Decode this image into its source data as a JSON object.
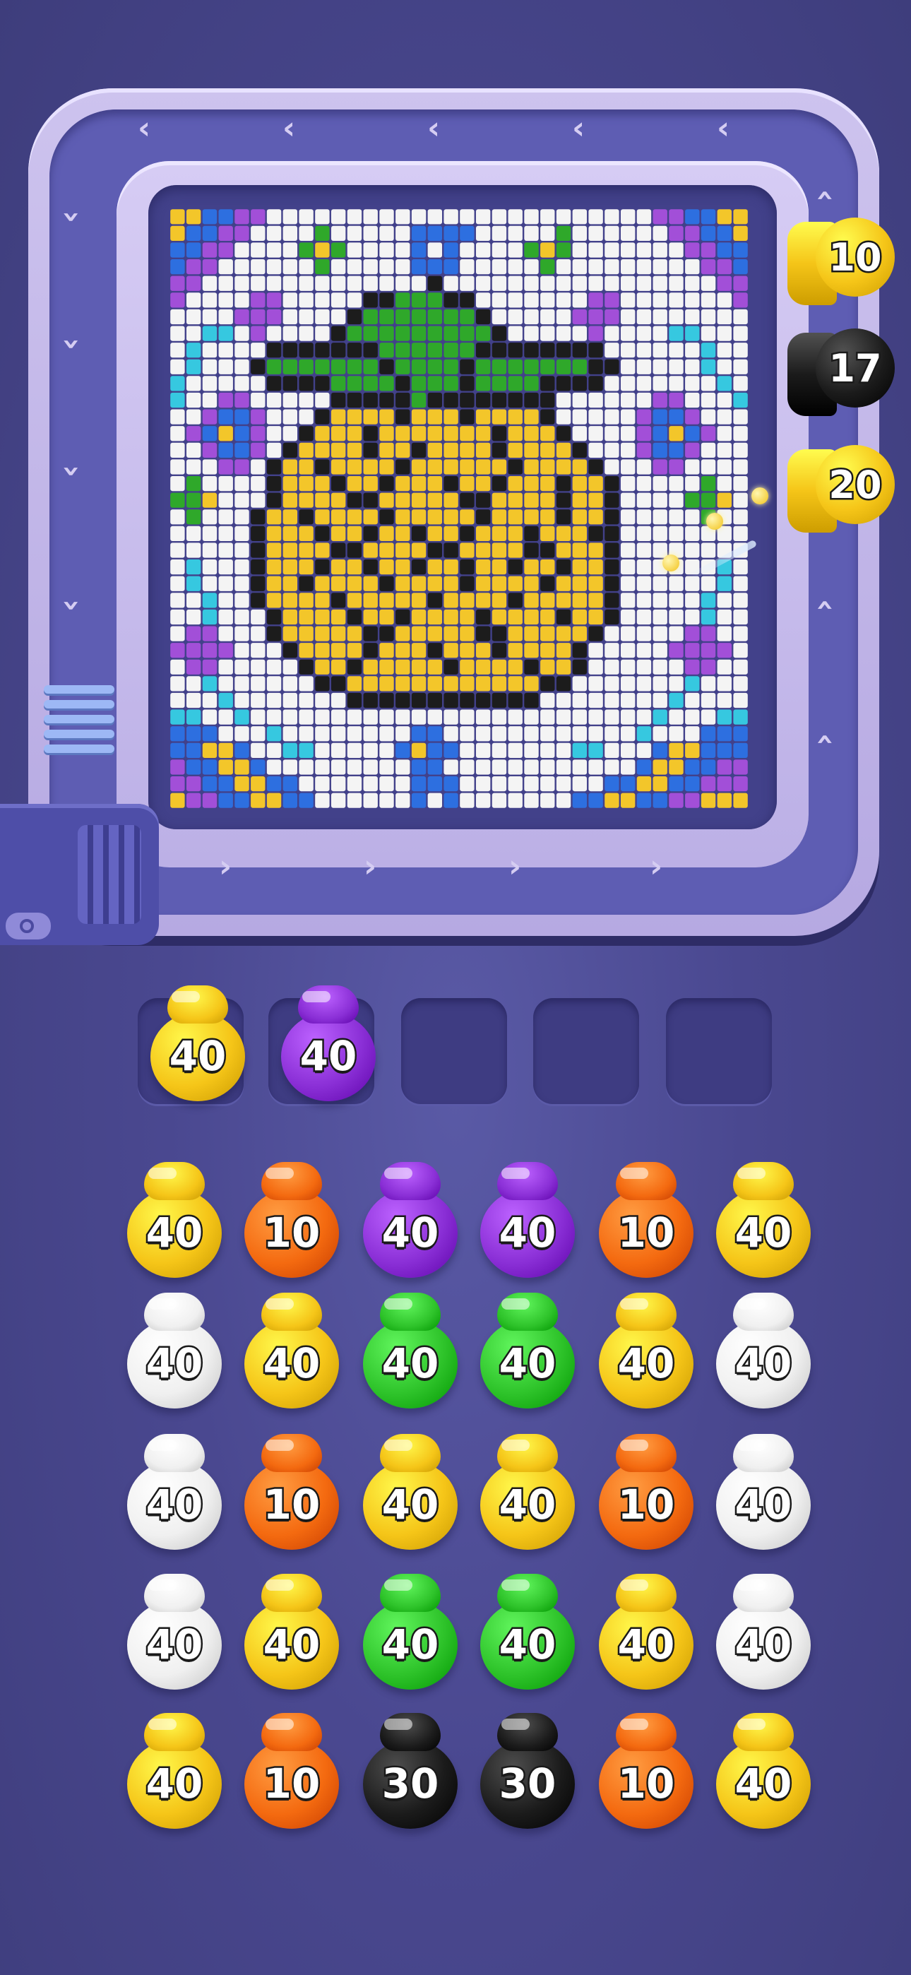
{
  "colors": {
    "yellow": "#f5c518",
    "orange": "#f46a10",
    "purple": "#8a2fd6",
    "green": "#2ec32a",
    "white": "#f0f0f0",
    "black": "#1b1b1b"
  },
  "picture": {
    "subject": "pineapple",
    "rows": [
      "yybbppwwwwwwwwwwwwwwwwwwwwwwwwppbbyy",
      "ybbppwwwwgwwwwwbbbbwwwwwgwwwwwwppbby",
      "bbppwwwwgygwwwwbwbwwwwgygwwwwwwwppbb",
      "bppwwwwwwgwwwwwbbbwwwwwgwwwwwwwwwppb",
      "ppwwwwwwwwwwwwwwkwwwwwwwwwwwwwwwwwpp",
      "pwwwwppwwwwwkkgggkkwwwwwwwppwwwwwwwp",
      "wwwwpppwwwwkgggggggkwwwwwpppwwwwwwww",
      "wwccwpwwwwkgggggggggkwwwwwpwwwwccwww",
      "wcwwwwkkkkkkkggggggkkkkkkkkwwwwwwcww",
      "wcwwwkgggggggkggggkgggggggkkwwwwwcww",
      "cwwwwwkkkkggggkgggkggggkkkkwwwwwwwcw",
      "cwwppwwwwwkkkkkgkkkkkkkkwwwwwwppwwwc",
      "wwpbbpwwwkyyyykyyykyyyykwwwwwpbbpwww",
      "wpbybpwwkyyykyyyyyyykyyykwwwwpbybpww",
      "wwpbbpwkyyyykyykyyyykyyyykwwwpbbpwww",
      "wwwppwkyykyyyykyyyyyykyyyykwwwppwwww",
      "wgwwwwkyyykyykyyykyykyyykyykwwwwwgww",
      "ggywwwkyyyykkyyyyykkyyyykyykwwwwggyw",
      "wgwwwkyykyyyykyyyyykyyyykyykwwwwwgww",
      "wwwwwkyyykyykyykyykyyykyyykkwwwwwwww",
      "wwwwwkyyyykkyyyykkyyyykkyyykwwwwwwww",
      "wcwwwkyyykyykyykyykyykyykyykwwwwwwcw",
      "wcwwwkyykyyyykyyyykyyyykyyykwwwwwwcw",
      "wwcwwkyyyykyyyyykyyyykyyyyykwwwwwcww",
      "wwcwwwkyyyykyykyyyykyyyykyykwwwwwcww",
      "wppwwwkyyyyykkyyyyykkyyyyykwwwwwppww",
      "ppppwwwkyyyykyyykyyykyyyykwwwwwppppw",
      "wppwwwwwkyykyyyyykyyyykyykwwwwwwppww",
      "wwcwwwwwwkkyyyyyyyyyyyykkwwwwwwwcwww",
      "wwwcwwwwwwwkkkkkkkkkkkkwwwwwwwwcwwww",
      "ccwwcwwwwwwwwwwwwwwwwwwwwwwwwwcwwwcc",
      "bbbwwwcwwwwwwwwbbwwwwwwwwwwwwcwwwbbb",
      "bbyybwwccwwwwwbybbwwwwwwwccwwwbyybbb",
      "pbbyybwwwwwwwwwbbwwwwwwwwwwwwbyybbpp",
      "ppbbyybbwwwwwwwbbbwwwwwwwwwbbyybbppp",
      "yppbbyybbwwwwwwbwbwwwwwwwbbyybbppyyy"
    ]
  },
  "side_shooters": [
    {
      "value": "10",
      "color": "#f5c518"
    },
    {
      "value": "17",
      "color": "#1b1b1b"
    },
    {
      "value": "20",
      "color": "#f5c518"
    }
  ],
  "queue_slots": [
    {
      "value": "40",
      "color": "#f5c518",
      "filled": true
    },
    {
      "value": "40",
      "color": "#8a2fd6",
      "filled": true
    },
    {
      "value": "",
      "color": "",
      "filled": false
    },
    {
      "value": "",
      "color": "",
      "filled": false
    },
    {
      "value": "",
      "color": "",
      "filled": false
    }
  ],
  "pots": [
    [
      {
        "value": "40",
        "color": "#f5c518"
      },
      {
        "value": "10",
        "color": "#f46a10"
      },
      {
        "value": "40",
        "color": "#8a2fd6"
      },
      {
        "value": "40",
        "color": "#8a2fd6"
      },
      {
        "value": "10",
        "color": "#f46a10"
      },
      {
        "value": "40",
        "color": "#f5c518"
      }
    ],
    [
      {
        "value": "40",
        "color": "#f0f0f0"
      },
      {
        "value": "40",
        "color": "#f5c518"
      },
      {
        "value": "40",
        "color": "#2ec32a"
      },
      {
        "value": "40",
        "color": "#2ec32a"
      },
      {
        "value": "40",
        "color": "#f5c518"
      },
      {
        "value": "40",
        "color": "#f0f0f0"
      }
    ],
    [
      {
        "value": "40",
        "color": "#f0f0f0"
      },
      {
        "value": "10",
        "color": "#f46a10"
      },
      {
        "value": "40",
        "color": "#f5c518"
      },
      {
        "value": "40",
        "color": "#f5c518"
      },
      {
        "value": "10",
        "color": "#f46a10"
      },
      {
        "value": "40",
        "color": "#f0f0f0"
      }
    ],
    [
      {
        "value": "40",
        "color": "#f0f0f0"
      },
      {
        "value": "40",
        "color": "#f5c518"
      },
      {
        "value": "40",
        "color": "#2ec32a"
      },
      {
        "value": "40",
        "color": "#2ec32a"
      },
      {
        "value": "40",
        "color": "#f5c518"
      },
      {
        "value": "40",
        "color": "#f0f0f0"
      }
    ],
    [
      {
        "value": "40",
        "color": "#f5c518"
      },
      {
        "value": "10",
        "color": "#f46a10"
      },
      {
        "value": "30",
        "color": "#1b1b1b"
      },
      {
        "value": "30",
        "color": "#1b1b1b"
      },
      {
        "value": "10",
        "color": "#f46a10"
      },
      {
        "value": "40",
        "color": "#f5c518"
      }
    ]
  ]
}
